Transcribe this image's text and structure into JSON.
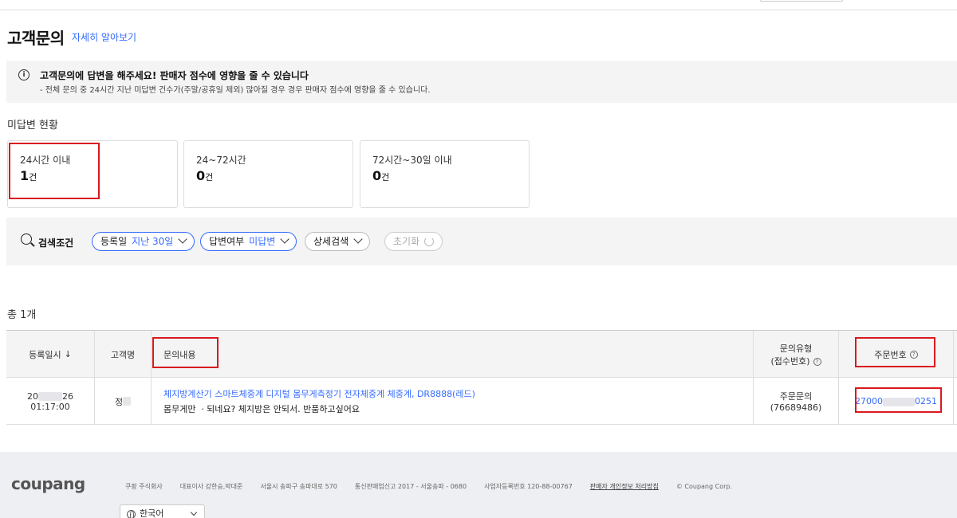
{
  "header": {
    "title": "고객문의",
    "learn_more_link": "자세히 알아보기"
  },
  "notice": {
    "icon": "info-icon",
    "title": "고객문의에 답변을 해주세요! 판매자 점수에 영향을 줄 수 있습니다",
    "description": "- 전체 문의 중 24시간 지난 미답변 건수가(주말/공휴일 제외) 많아질 경우 경우 판매자 점수에 영향을 줄 수 있습니다."
  },
  "unanswered": {
    "label": "미답변 현황",
    "cards": [
      {
        "label": "24시간 이내",
        "count": "1",
        "unit": "건"
      },
      {
        "label": "24~72시간",
        "count": "0",
        "unit": "건"
      },
      {
        "label": "72시간~30일 이내",
        "count": "0",
        "unit": "건"
      }
    ]
  },
  "search": {
    "label": "검색조건",
    "filters": [
      {
        "key": "등록일",
        "value": "지난 30일"
      },
      {
        "key": "답변여부",
        "value": "미답변"
      }
    ],
    "detail_search": "상세검색",
    "reset": "초기화"
  },
  "results": {
    "total": "총 1개"
  },
  "table": {
    "headers": {
      "date": "등록일시",
      "sort_indicator": "↓",
      "customer": "고객명",
      "content": "문의내용",
      "type_line1": "문의유형",
      "type_line2": "(접수번호)",
      "order_no": "주문번호"
    },
    "rows": [
      {
        "date_prefix": "20",
        "date_suffix": "26",
        "time": "01:17:00",
        "customer_prefix": "정",
        "product": "체지방계산기 스마트체중계 디지털 몸무게측정기 전자체중계 체중계, DR8888(레드)",
        "message": "몸무게만 ㆍ되네요? 체지방은 안되서. 반품하고싶어요",
        "type": "주문문의",
        "receipt_no": "(76689486)",
        "order_prefix": "27000",
        "order_suffix": "0251"
      }
    ]
  },
  "footer": {
    "logo": "coupang",
    "company": "쿠팡 주식회사",
    "ceo": "대표이사 강한승,박대준",
    "address": "서울시 송파구 송파대로 570",
    "mail_order": "통신판매업신고 2017 - 서울송파 - 0680",
    "business_no": "사업자등록번호 120-88-00767",
    "privacy": "판매자 개인정보 처리방침",
    "copyright": "© Coupang Corp.",
    "language": "한국어"
  },
  "colors": {
    "accent": "#346aff",
    "highlight_box": "#d9191f",
    "panel_bg": "#f4f4f5",
    "footer_bg": "#eeeff2"
  }
}
